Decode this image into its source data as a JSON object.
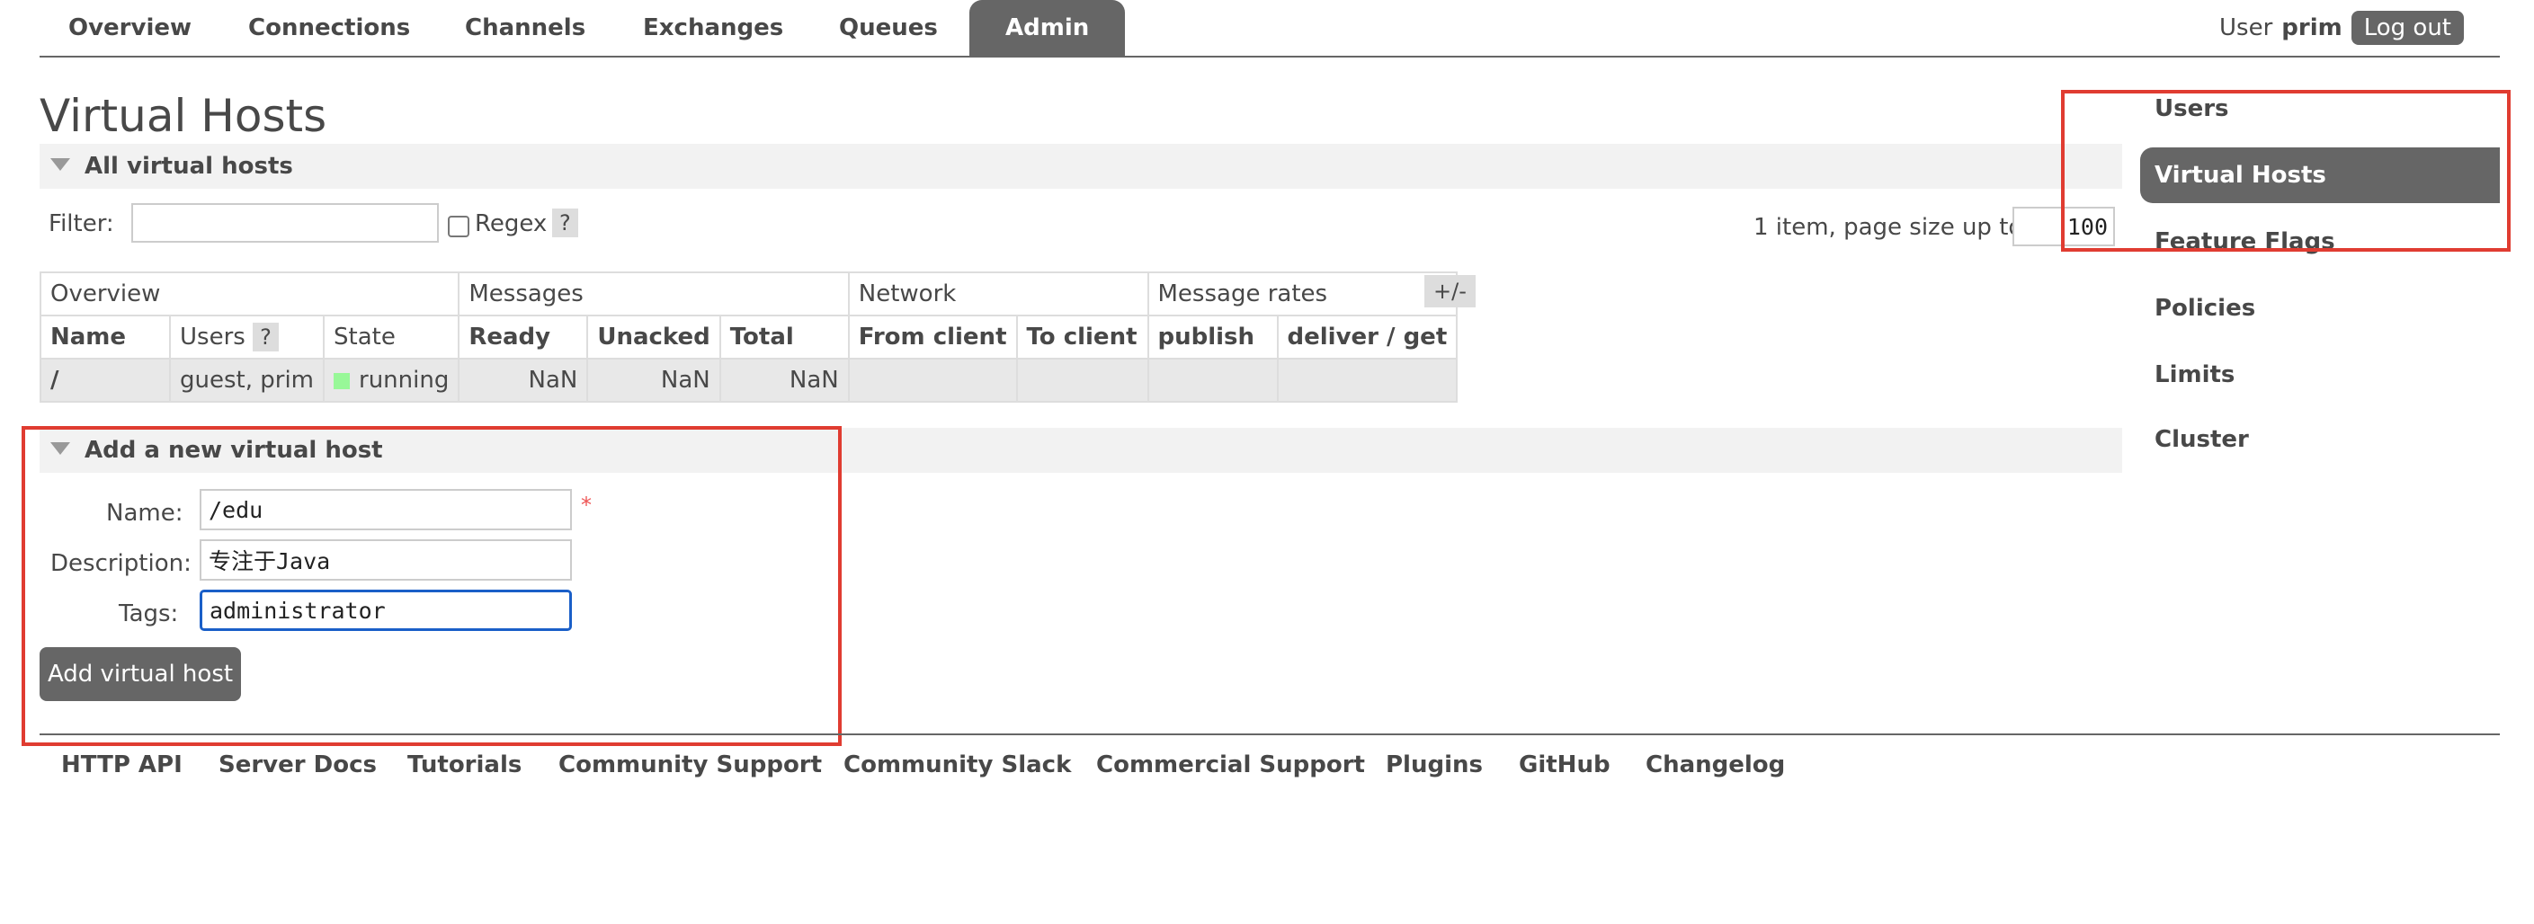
{
  "nav": {
    "tabs": [
      "Overview",
      "Connections",
      "Channels",
      "Exchanges",
      "Queues",
      "Admin"
    ],
    "active_tab": "Admin"
  },
  "user": {
    "label": "User",
    "name": "prim",
    "logout": "Log out"
  },
  "page": {
    "title": "Virtual Hosts"
  },
  "all_hosts": {
    "section_title": "All virtual hosts",
    "filter_label": "Filter:",
    "filter_value": "",
    "regex_label": "Regex",
    "regex_checked": false,
    "help_glyph": "?",
    "paging_text": "1 item, page size up to",
    "page_size": "100",
    "columns_toggle": "+/-"
  },
  "table": {
    "group_headers": [
      "Overview",
      "Messages",
      "Network",
      "Message rates"
    ],
    "headers": [
      "Name",
      "Users",
      "State",
      "Ready",
      "Unacked",
      "Total",
      "From client",
      "To client",
      "publish",
      "deliver / get"
    ],
    "users_help": "?",
    "rows": [
      {
        "name": "/",
        "users": "guest, prim",
        "state": "running",
        "ready": "NaN",
        "unacked": "NaN",
        "total": "NaN",
        "from_client": "",
        "to_client": "",
        "publish": "",
        "deliver_get": ""
      }
    ],
    "state_color": "#98f898"
  },
  "add_form": {
    "section_title": "Add a new virtual host",
    "name_label": "Name:",
    "name_value": "/edu",
    "required_mark": "*",
    "desc_label": "Description:",
    "desc_value": "专注于Java",
    "tags_label": "Tags:",
    "tags_value": "administrator",
    "submit": "Add virtual host"
  },
  "sidebar": {
    "items": [
      "Users",
      "Virtual Hosts",
      "Feature Flags",
      "Policies",
      "Limits",
      "Cluster"
    ],
    "active": "Virtual Hosts"
  },
  "footer": {
    "links": [
      "HTTP API",
      "Server Docs",
      "Tutorials",
      "Community Support",
      "Community Slack",
      "Commercial Support",
      "Plugins",
      "GitHub",
      "Changelog"
    ]
  },
  "colors": {
    "accent_gray": "#666666",
    "annotation_red": "#e03c31",
    "focus_blue": "#1a5fc8"
  }
}
